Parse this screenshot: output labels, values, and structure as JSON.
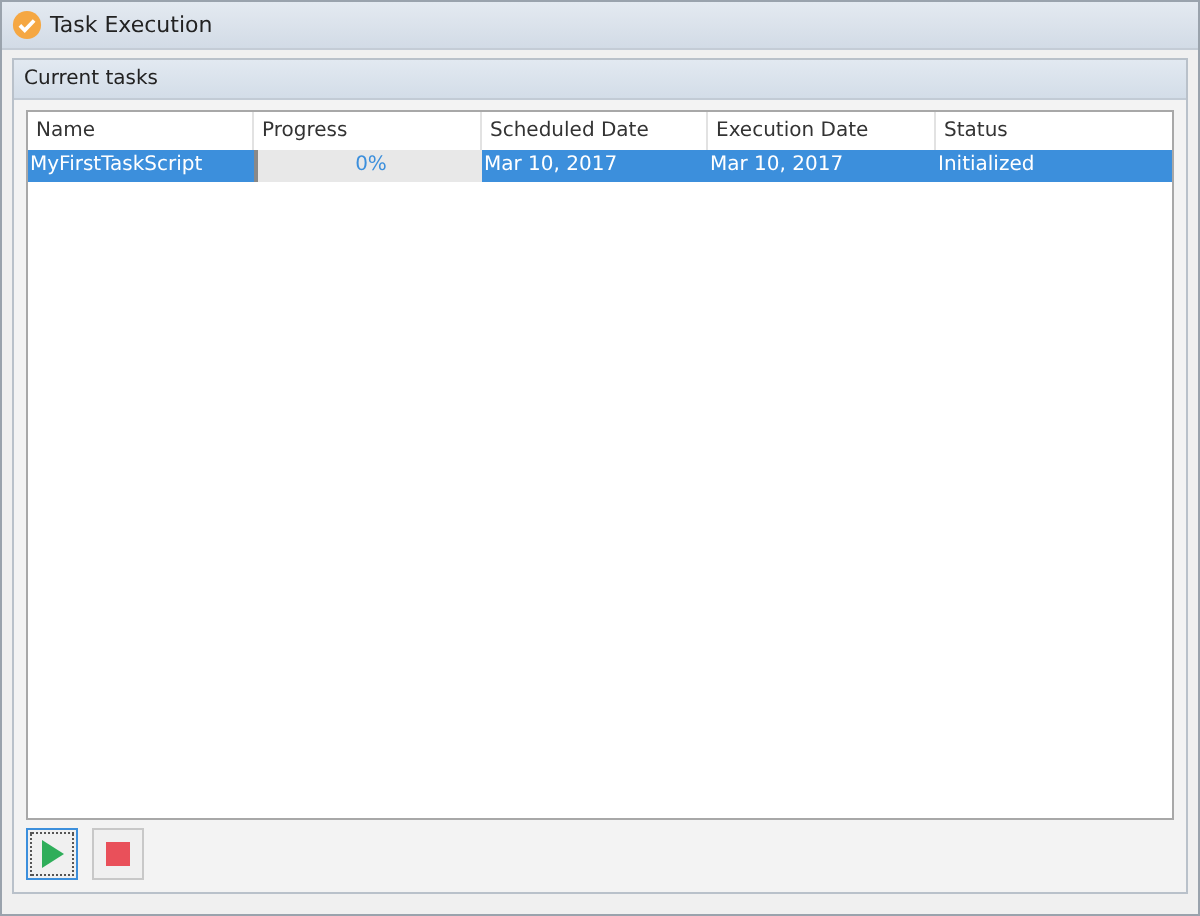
{
  "window": {
    "title": "Task Execution"
  },
  "group": {
    "title": "Current tasks"
  },
  "table": {
    "columns": [
      "Name",
      "Progress",
      "Scheduled Date",
      "Execution Date",
      "Status"
    ],
    "rows": [
      {
        "name": "MyFirstTaskScript",
        "progress": {
          "level": 0,
          "reading": "0%"
        },
        "scheduled_date": "Mar 10, 2017",
        "execution_date": "Mar 10, 2017",
        "status": "Initialized",
        "selected": true
      }
    ]
  },
  "buttons": [
    {
      "kind": "play",
      "focused": true
    },
    {
      "kind": "stop",
      "focused": false
    }
  ]
}
